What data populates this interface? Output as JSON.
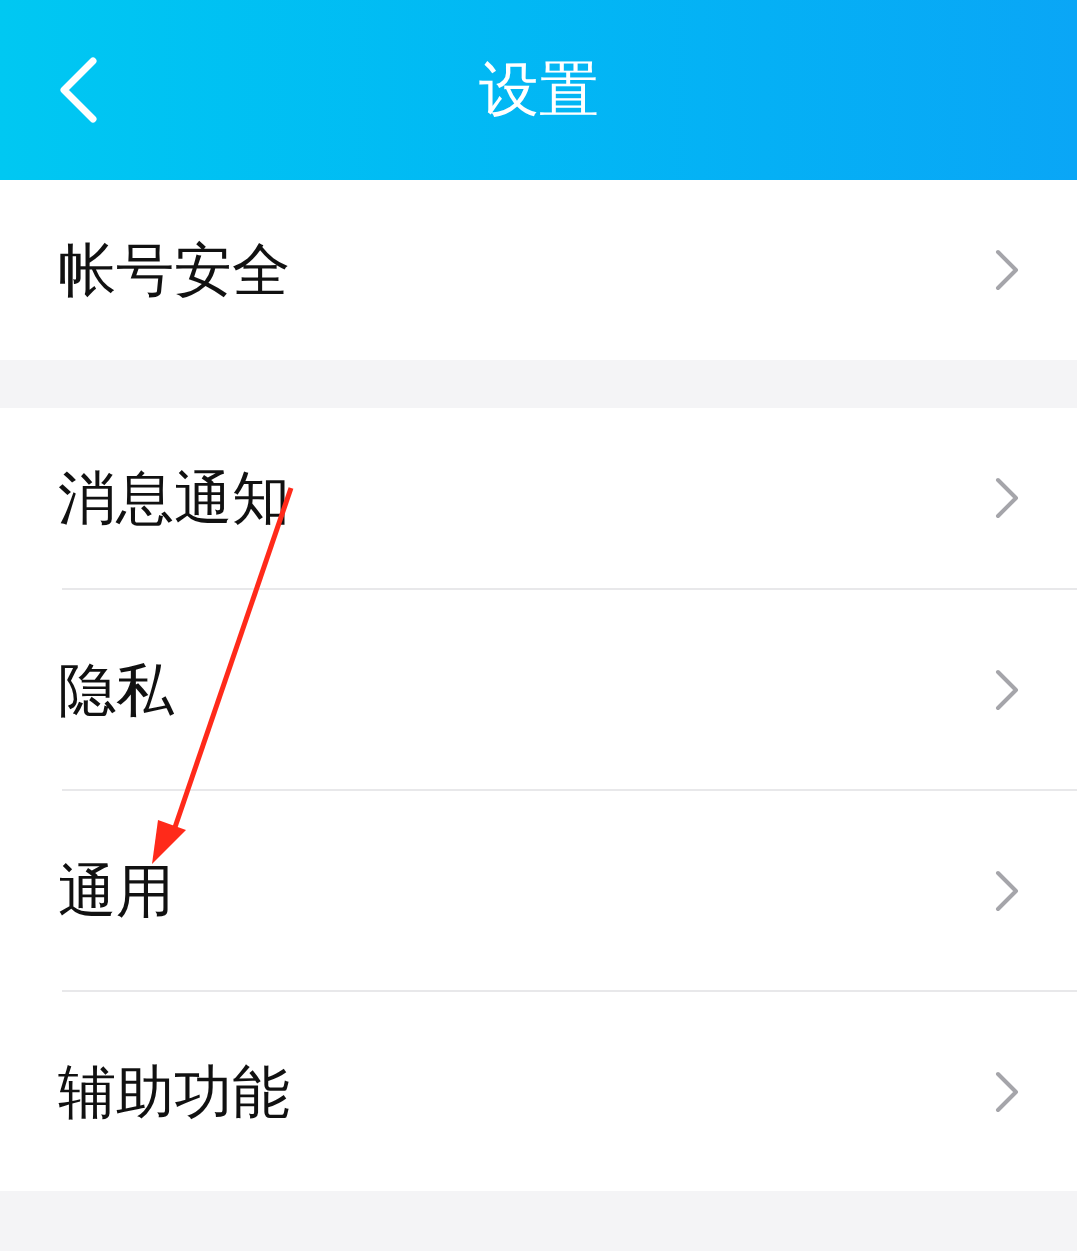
{
  "header": {
    "title": "设置"
  },
  "groups": [
    {
      "items": [
        {
          "label": "帐号安全"
        }
      ]
    },
    {
      "items": [
        {
          "label": "消息通知"
        },
        {
          "label": "隐私"
        },
        {
          "label": "通用"
        },
        {
          "label": "辅助功能"
        }
      ]
    }
  ]
}
